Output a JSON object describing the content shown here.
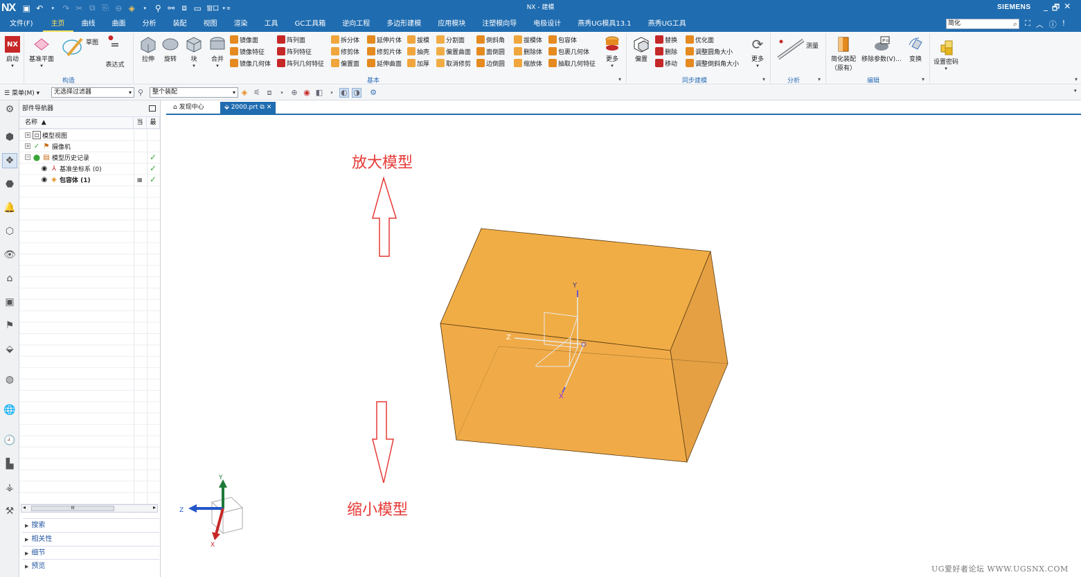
{
  "titlebar": {
    "logo": "NX",
    "title": "NX - 建模",
    "brand": "SIEMENS",
    "window_label": "窗口",
    "minimize": "_",
    "restore": "🗗",
    "close": "✕"
  },
  "menubar": {
    "tabs": [
      "文件(F)",
      "主页",
      "曲线",
      "曲面",
      "分析",
      "装配",
      "视图",
      "渲染",
      "工具",
      "GC工具箱",
      "逆向工程",
      "多边形建模",
      "应用模块",
      "注塑模向导",
      "电极设计",
      "燕秀UG模具13.1",
      "燕秀UG工具"
    ],
    "active_index": 1,
    "search_value": "简化"
  },
  "ribbon": {
    "big_buttons": {
      "start": "启动",
      "datum_plane": "基准平面",
      "sketch": "草图",
      "expression": "表达式",
      "extrude": "拉伸",
      "revolve": "旋转",
      "block": "块",
      "unite": "合并",
      "more_basic": "更多",
      "offset": "偏置",
      "more_sync": "更多",
      "measure": "测量",
      "simplify_assembly": "简化装配",
      "simplify_assembly_sub": "（原有）",
      "remove_params": "移除参数(V)...",
      "transform": "变换",
      "set_password": "设置密码"
    },
    "small": {
      "col1": [
        "镜像面",
        "镜像特征",
        "镜像几何体"
      ],
      "col2": [
        "阵列面",
        "阵列特征",
        "阵列几何特征"
      ],
      "col3": [
        "拆分体",
        "修剪体",
        "偏置面"
      ],
      "col4": [
        "延伸片体",
        "修剪片体",
        "延伸曲面"
      ],
      "col5": [
        "拔模",
        "抽壳",
        "加厚"
      ],
      "col6": [
        "分割面",
        "偏置曲面",
        "取消修剪"
      ],
      "col7": [
        "倒斜角",
        "面倒圆",
        "边倒圆"
      ],
      "col8": [
        "拔模体",
        "删除体",
        "缩放体"
      ],
      "col9": [
        "包容体",
        "包裹几何体",
        "抽取几何特征"
      ],
      "sync1": [
        "替换",
        "删除",
        "移动"
      ],
      "sync2": [
        "优化面",
        "调整圆角大小",
        "调整倒斜角大小"
      ]
    },
    "groups": {
      "construct": "构造",
      "basic": "基本",
      "sync": "同步建模",
      "analysis": "分析",
      "edit": "编辑"
    }
  },
  "toolrow": {
    "menu": "菜单(M)",
    "filter": "无选择过滤器",
    "assembly": "整个装配"
  },
  "navigator": {
    "title": "部件导航器",
    "col_name": "名称",
    "col_current": "当",
    "col_latest": "最",
    "rows": [
      {
        "label": "模型视图",
        "bold": false
      },
      {
        "label": "摄像机",
        "bold": false
      },
      {
        "label": "模型历史记录",
        "bold": false
      },
      {
        "label": "基准坐标系 (0)",
        "bold": false
      },
      {
        "label": "包容体 (1)",
        "bold": true
      }
    ],
    "scroll_thumb": "III",
    "sections": [
      "搜索",
      "相关性",
      "细节",
      "预览"
    ]
  },
  "doctabs": {
    "discover": "发现中心",
    "part": "2000.prt"
  },
  "viewport": {
    "annotation_top": "放大模型",
    "annotation_bottom": "缩小模型",
    "wcs_y": "Y",
    "wcs_z": "Z",
    "wcs_x": "X",
    "triad_y": "Y",
    "triad_z": "Z",
    "triad_x": "X",
    "box_color": "#f1ad45",
    "annotation_color": "#e53935"
  },
  "watermark": "UG爱好者论坛 WWW.UGSNX.COM"
}
